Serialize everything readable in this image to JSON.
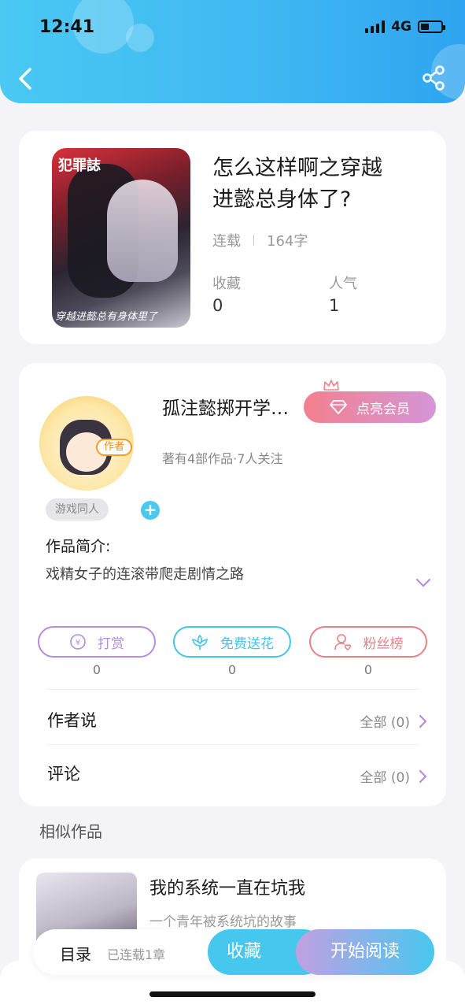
{
  "status_bar": {
    "time": "12:41",
    "network": "4G"
  },
  "header": {
    "back_icon": "chevron-left-icon",
    "share_icon": "share-icon"
  },
  "book": {
    "cover_top_text": "犯罪誌",
    "cover_bottom_text": "穿越进懿总有身体里了",
    "title_line1": "怎么这样啊之穿越",
    "title_line2": "进懿总身体了?",
    "status": "连载",
    "word_count": "164字",
    "favorites_label": "收藏",
    "favorites_value": "0",
    "popularity_label": "人气",
    "popularity_value": "1"
  },
  "author": {
    "badge": "作者",
    "name": "孤注懿掷开学…",
    "vip_button": "点亮会员",
    "stats": "著有4部作品·7人关注",
    "tag": "游戏同人",
    "tag_add": "+",
    "intro_label": "作品简介:",
    "intro_text": "戏精女子的连滚带爬走剧情之路"
  },
  "actions": [
    {
      "label": "打赏",
      "count": "0",
      "icon": "yen-coin-icon",
      "color": "#b58ce0"
    },
    {
      "label": "免费送花",
      "count": "0",
      "icon": "flower-icon",
      "color": "#45c3ea"
    },
    {
      "label": "粉丝榜",
      "count": "0",
      "icon": "fan-user-icon",
      "color": "#ea7f86"
    }
  ],
  "rows": {
    "author_says_label": "作者说",
    "author_says_right": "全部 (0)",
    "comments_label": "评论",
    "comments_right": "全部 (0)"
  },
  "similar": {
    "section_title": "相似作品",
    "item_title": "我的系统一直在坑我",
    "item_desc": "一个青年被系统坑的故事"
  },
  "bottom_bar": {
    "toc_label": "目录",
    "chapters": "已连载1章",
    "favorite_button": "收藏",
    "read_button": "开始阅读"
  },
  "colors": {
    "header": "#3fb6f2",
    "accent_blue": "#45c7ee",
    "vip_pink": "#f2808e",
    "purple": "#b58ce0"
  }
}
